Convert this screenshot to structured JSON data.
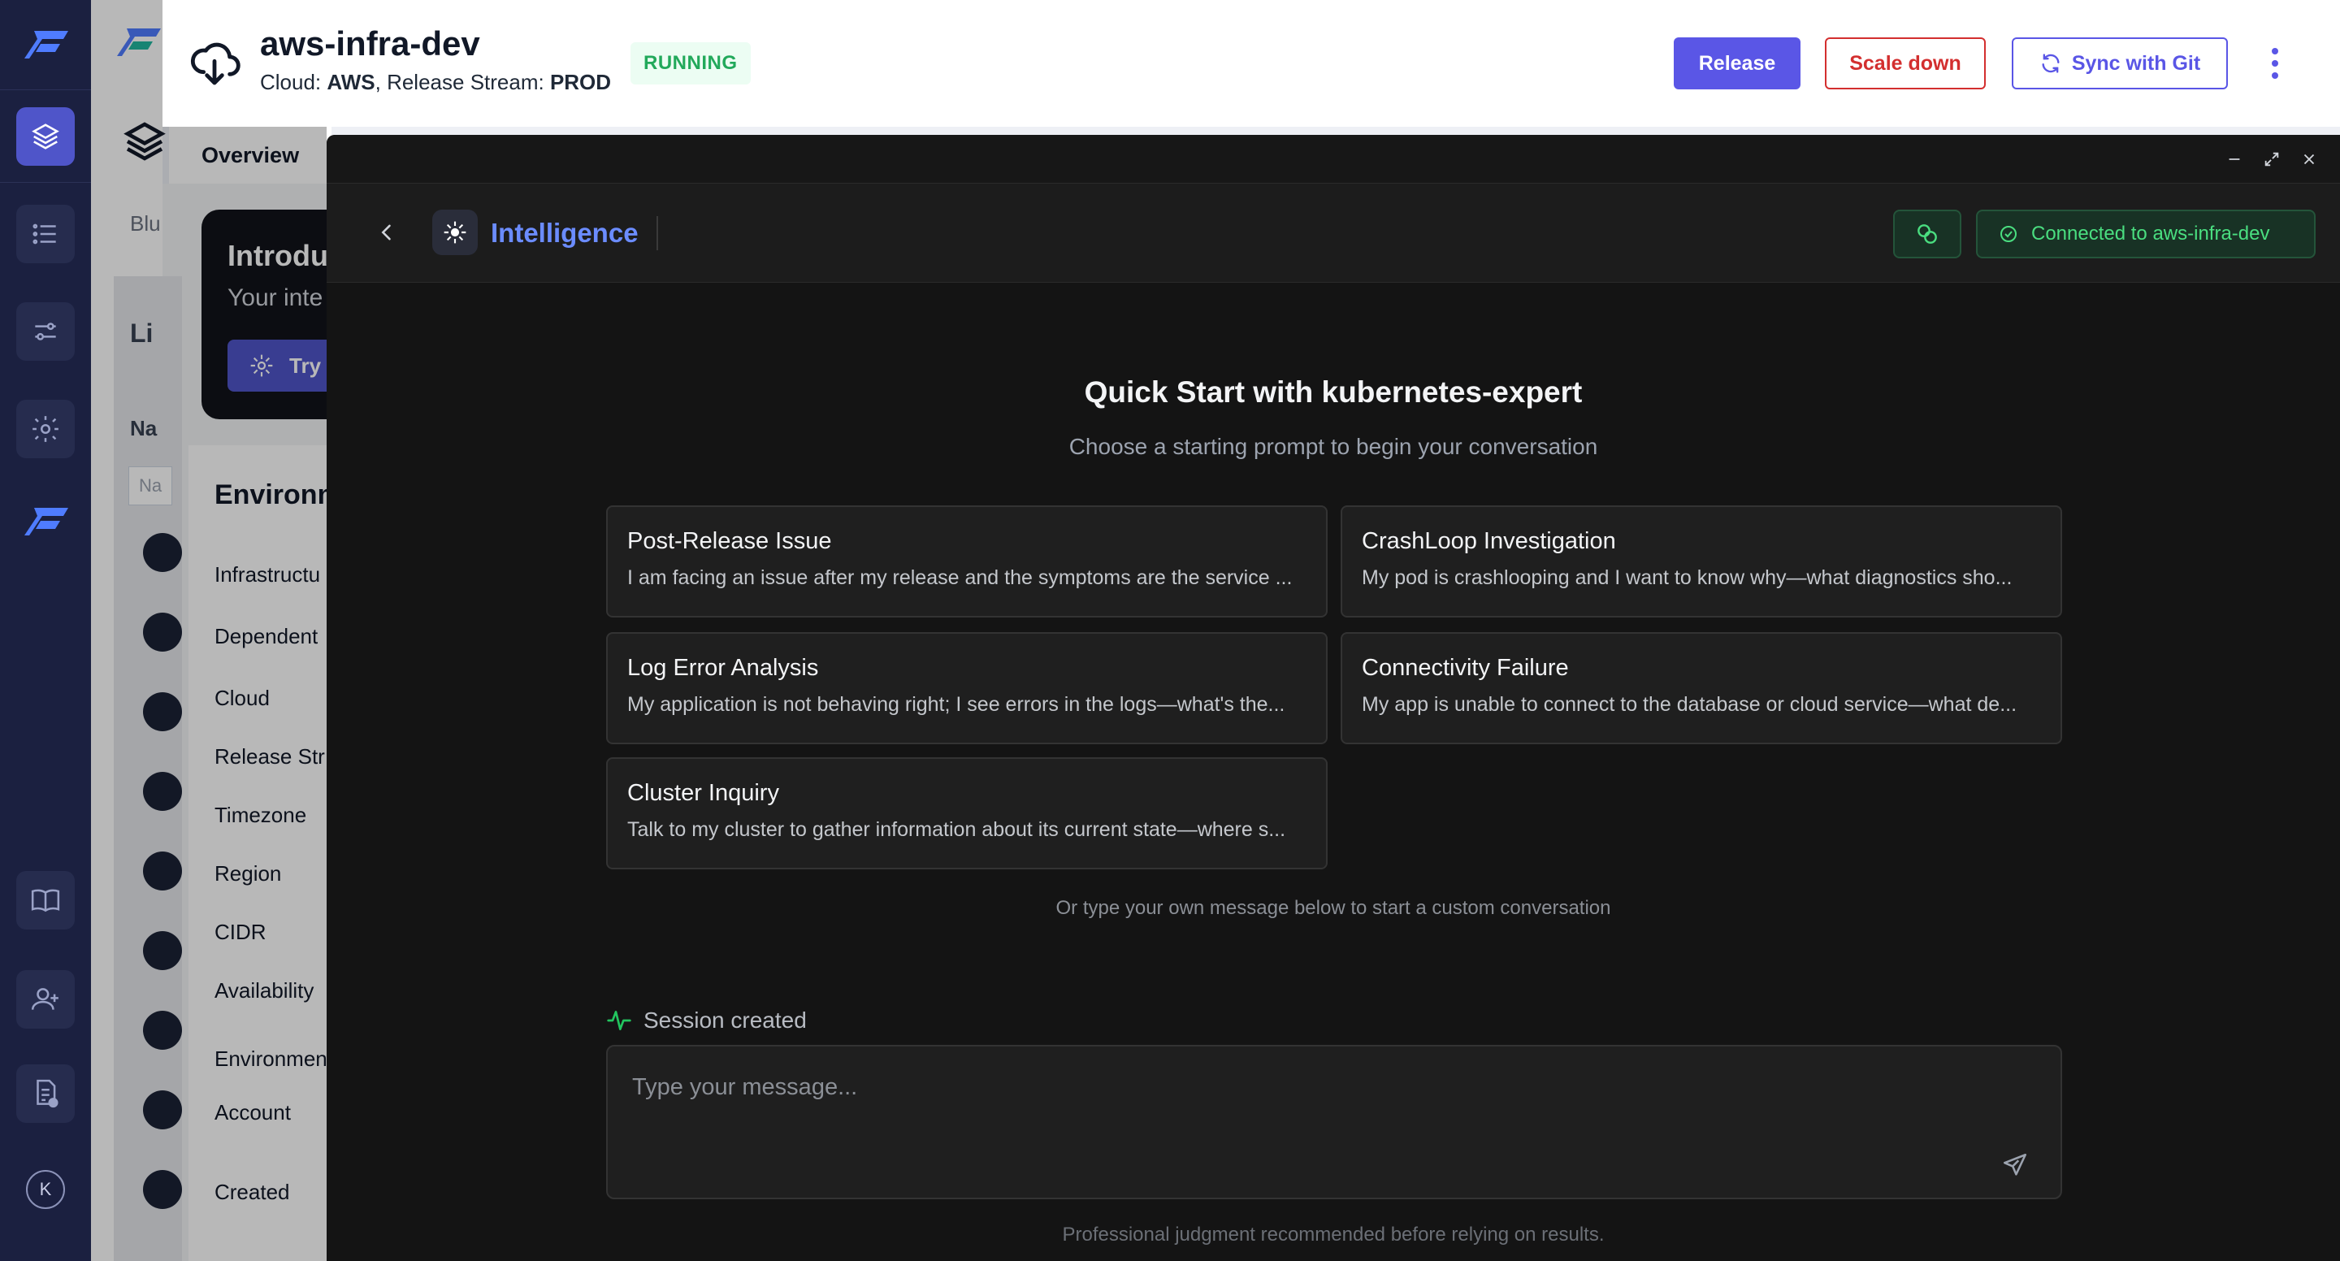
{
  "header": {
    "title": "aws-infra-dev",
    "cloud_label": "Cloud: ",
    "cloud_value": "AWS",
    "stream_label": ", Release Stream: ",
    "stream_value": "PROD",
    "status": "RUNNING",
    "release_label": "Release",
    "scale_down_label": "Scale down",
    "sync_label": "Sync with Git"
  },
  "tabs": {
    "overview": "Overview"
  },
  "background": {
    "intro_title": "Introdu",
    "intro_sub": "Your inte",
    "try_label": "Try",
    "list_heading": "Li",
    "blu": "Blu",
    "na": "Na",
    "na_input": "Na",
    "env_title": "Environm",
    "env_rows": [
      "Infrastructu",
      "Dependent",
      "Cloud",
      "Release Str",
      "Timezone",
      "Region",
      "CIDR",
      "Availability",
      "Environmen",
      "Account",
      "Created"
    ]
  },
  "intelligence": {
    "title": "Intelligence",
    "connection": "Connected to aws-infra-dev",
    "quick_start_title": "Quick Start with kubernetes-expert",
    "quick_start_sub": "Choose a starting prompt to begin your conversation",
    "prompts": [
      {
        "title": "Post-Release Issue",
        "desc": "I am facing an issue after my release and the symptoms are the service ..."
      },
      {
        "title": "CrashLoop Investigation",
        "desc": "My pod is crashlooping and I want to know why—what diagnostics sho..."
      },
      {
        "title": "Log Error Analysis",
        "desc": "My application is not behaving right; I see errors in the logs—what's the..."
      },
      {
        "title": "Connectivity Failure",
        "desc": "My app is unable to connect to the database or cloud service—what de..."
      },
      {
        "title": "Cluster Inquiry",
        "desc": "Talk to my cluster to gather information about its current state—where s..."
      }
    ],
    "custom_hint": "Or type your own message below to start a custom conversation",
    "session_status": "Session created",
    "message_placeholder": "Type your message...",
    "message_value": "",
    "disclaimer": "Professional judgment recommended before relying on results."
  },
  "user": {
    "initial": "K"
  },
  "colors": {
    "rail_bg": "#1b2040",
    "accent": "#5a56e6",
    "danger": "#d32f2f",
    "running": "#22a95b",
    "panel_bg": "#141414",
    "intel_blue": "#6b8cff",
    "connected_green": "#4ade80"
  }
}
